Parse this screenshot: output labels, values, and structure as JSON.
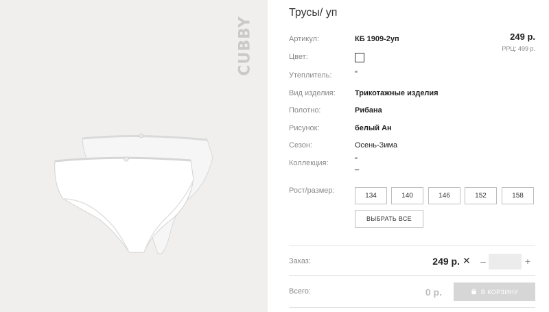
{
  "product": {
    "title": "Трусы/ уп",
    "brand": "CUBBY",
    "price": "249 р.",
    "rrp": "РРЦ: 499 р."
  },
  "attributes": [
    {
      "label": "Артикул:",
      "value": "КБ 1909-2уп"
    },
    {
      "label": "Цвет:",
      "value": ""
    },
    {
      "label": "Утеплитель:",
      "value": "\""
    },
    {
      "label": "Вид изделия:",
      "value": "Трикотажные изделия"
    },
    {
      "label": "Полотно:",
      "value": "Рибана"
    },
    {
      "label": "Рисунок:",
      "value": "белый Ан"
    },
    {
      "label": "Сезон:",
      "value": "Осень-Зима"
    },
    {
      "label": "Коллекция:",
      "value": "\"\n_"
    }
  ],
  "sizes": {
    "label": "Рост/размер:",
    "options": [
      "134",
      "140",
      "146",
      "152",
      "158"
    ],
    "select_all_label": "ВЫБРАТЬ ВСЕ"
  },
  "order": {
    "label": "Заказ:",
    "price": "249 р.",
    "remove_icon": "close-icon",
    "minus": "–",
    "quantity": "",
    "plus": "+"
  },
  "total": {
    "label": "Всего:",
    "value": "0 р.",
    "cart_button_label": "В КОРЗИНУ",
    "cart_icon": "cart-icon"
  }
}
